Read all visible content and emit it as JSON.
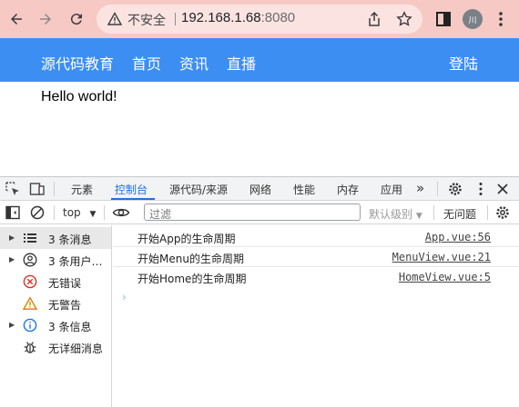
{
  "browser": {
    "insecure_label": "不安全",
    "url_host": "192.168.1.68",
    "url_port": ":8080",
    "profile_initial": "川"
  },
  "site": {
    "nav_links": [
      "源代码教育",
      "首页",
      "资讯",
      "直播"
    ],
    "login": "登陆",
    "hello": "Hello world!"
  },
  "devtools": {
    "tabs": [
      "元素",
      "控制台",
      "源代码/来源",
      "网络",
      "性能",
      "内存",
      "应用"
    ],
    "active_tab": "控制台",
    "more_tabs": "»",
    "context": "top",
    "filter_placeholder": "过滤",
    "levels": "默认级别",
    "issues": "无问题",
    "sidebar": [
      {
        "label": "3 条消息",
        "icon": "list-icon",
        "caret": true
      },
      {
        "label": "3 条用户…",
        "icon": "user-icon",
        "caret": true
      },
      {
        "label": "无错误",
        "icon": "error-icon",
        "caret": false
      },
      {
        "label": "无警告",
        "icon": "warning-icon",
        "caret": false
      },
      {
        "label": "3 条信息",
        "icon": "info-icon",
        "caret": true
      },
      {
        "label": "无详细消息",
        "icon": "bug-icon",
        "caret": false
      }
    ],
    "logs": [
      {
        "message": "开始App的生命周期",
        "source": "App.vue:56"
      },
      {
        "message": "开始Menu的生命周期",
        "source": "MenuView.vue:21"
      },
      {
        "message": "开始Home的生命周期",
        "source": "HomeView.vue:5"
      }
    ],
    "prompt": "›"
  },
  "colors": {
    "browser_bar": "#f6c9c5",
    "site_nav": "#3c8ef3",
    "accent": "#1a73e8",
    "error": "#d93025",
    "warning": "#e37400"
  }
}
